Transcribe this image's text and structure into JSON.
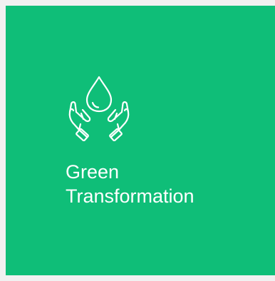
{
  "card": {
    "title": " Green\nTransformation",
    "icon": "hands-holding-water-drop-icon",
    "background_color": "#0fbe78",
    "text_color": "#ffffff",
    "page_background_color": "#f1f1f1"
  }
}
